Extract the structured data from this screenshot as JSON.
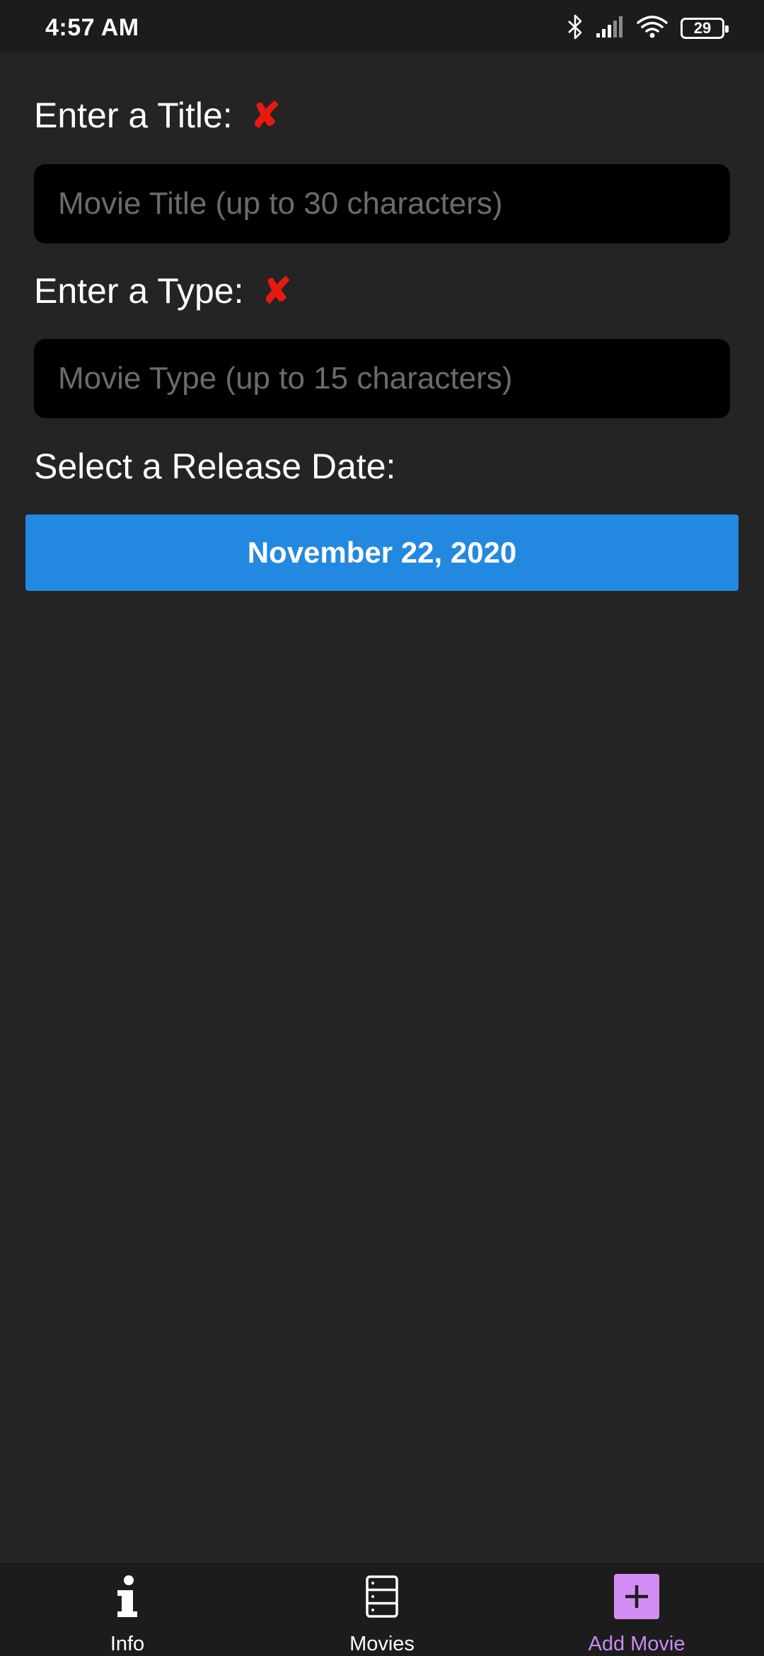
{
  "status_bar": {
    "time": "4:57 AM",
    "battery_level": "29",
    "icons": [
      "bluetooth-icon",
      "cellular-signal-icon",
      "wifi-icon",
      "battery-icon"
    ]
  },
  "form": {
    "title": {
      "label": "Enter a Title:",
      "invalid_mark": "✘",
      "value": "",
      "placeholder": "Movie Title (up to 30 characters)"
    },
    "type": {
      "label": "Enter a Type:",
      "invalid_mark": "✘",
      "value": "",
      "placeholder": "Movie Type (up to 15 characters)"
    },
    "release_date": {
      "label": "Select a Release Date:",
      "button_label": "November 22, 2020"
    }
  },
  "tabs": [
    {
      "label": "Info",
      "icon": "info-icon",
      "active": false
    },
    {
      "label": "Movies",
      "icon": "server-list-icon",
      "active": false
    },
    {
      "label": "Add Movie",
      "icon": "plus-icon",
      "active": true
    }
  ],
  "colors": {
    "background": "#242424",
    "input_background": "#000000",
    "invalid": "#e8190f",
    "date_button": "#2388e0",
    "active_tab": "#c98af0",
    "active_tab_icon_bg": "#d38ef5"
  }
}
